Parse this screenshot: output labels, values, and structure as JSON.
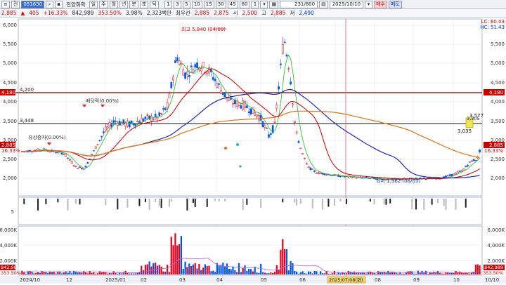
{
  "toolbar": {
    "menu_label": "≡",
    "market": "전",
    "stock_code": "051630",
    "stock_name": "진양화학",
    "period_buttons": [
      "주",
      "월",
      "년",
      "분",
      "초",
      "틱"
    ],
    "interval_buttons": [
      "1",
      "3",
      "5",
      "10",
      "15",
      "30",
      "45",
      "60"
    ],
    "stepper_value": "1",
    "date": "2025/10/10",
    "count": "231/600",
    "buy_label": "매수",
    "sell_label": "매도"
  },
  "quote": {
    "price": "2,885",
    "change": "405",
    "change_pct": "+16.33%",
    "volume": "842,989",
    "volume_ratio": "353.50%",
    "turnover": "3.98%",
    "amount": "2,323백만",
    "pref_label": "최우선",
    "pref_value": "2,885",
    "bid": "2,875",
    "open_label": "시",
    "open": "2,500",
    "high_label": "고",
    "high": "2,885",
    "low_label": "저",
    "low": "2,490"
  },
  "price_chart": {
    "y_ticks": [
      "6,000",
      "5,500",
      "5,000",
      "4,500",
      "4,000",
      "3,500",
      "3,000",
      "2,500",
      "2,000"
    ],
    "right_y_ticks": [
      "5,500",
      "5,000",
      "4,500",
      "4,000",
      "3,500",
      "3,000",
      "2,500",
      "2,000"
    ],
    "hc": "HC: 51.43",
    "lc": "LC: 60.03",
    "line_4200": "4,200",
    "line_3448": "3,448",
    "right_4180": "4,180",
    "right_price": "2,885",
    "right_pct": "16.33%",
    "left_price": "2,885",
    "left_pct": "16.33%",
    "annot_high": "최고 5,940 (04/09)",
    "annot_low": "최저 1,962 (08/05)",
    "annot_dividend": "배당락(0.00%)",
    "annot_rights": "유상증자(0.00%)",
    "annot_3577": "3,577",
    "annot_3305": "3,305",
    "annot_3035": "3,035"
  },
  "indicator": {
    "tick": "5"
  },
  "volume_chart": {
    "y_ticks": [
      "6,000K",
      "4,000K",
      "2,000K"
    ],
    "right_y_ticks": [
      "6,000K",
      "4,000K",
      "2,000K"
    ],
    "right_volume": "842,989",
    "right_ratio": "353.50%",
    "left_volume": "842,989",
    "left_ratio": "353.50%"
  },
  "x_axis": {
    "labels": [
      "2024/10",
      "12",
      "2025/01",
      "02",
      "03",
      "04",
      "05",
      "06",
      "07",
      "08",
      "09",
      "10",
      "10/10"
    ],
    "cursor_label": "2025/07/08(화)"
  },
  "colors": {
    "up": "#e0001b",
    "down": "#0057e6",
    "ma5": "#23b923",
    "ma20": "#c40000",
    "ma60": "#1f2aa8",
    "ma120": "#d8741e"
  }
}
